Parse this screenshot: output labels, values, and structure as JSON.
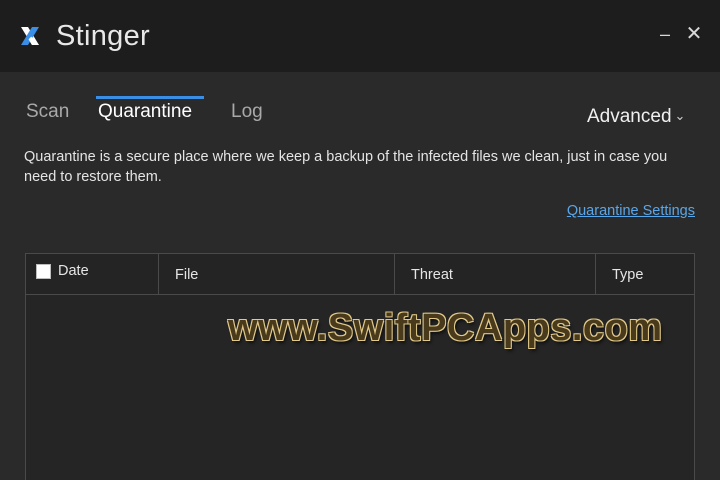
{
  "app": {
    "title": "Stinger",
    "logo_icon": "mcafee-x-logo-icon",
    "minimize_glyph": "–",
    "close_glyph": "✕"
  },
  "tabs": [
    {
      "label": "Scan",
      "active": false
    },
    {
      "label": "Quarantine",
      "active": true
    },
    {
      "label": "Log",
      "active": false
    }
  ],
  "advanced": {
    "label": "Advanced",
    "chevron_icon": "chevron-down-icon"
  },
  "description": "Quarantine is a secure place where we keep a backup of the infected files we clean, just in case you need to restore them.",
  "settings_link": "Quarantine Settings",
  "table": {
    "columns": [
      "Date",
      "File",
      "Threat",
      "Type"
    ],
    "select_all_checked": false,
    "rows": []
  },
  "watermark": "www.SwiftPCApps.com",
  "colors": {
    "titlebar_bg": "#1d1d1d",
    "body_bg": "#2a2a2a",
    "accent": "#3a8ee6",
    "link": "#5aa6e8"
  }
}
